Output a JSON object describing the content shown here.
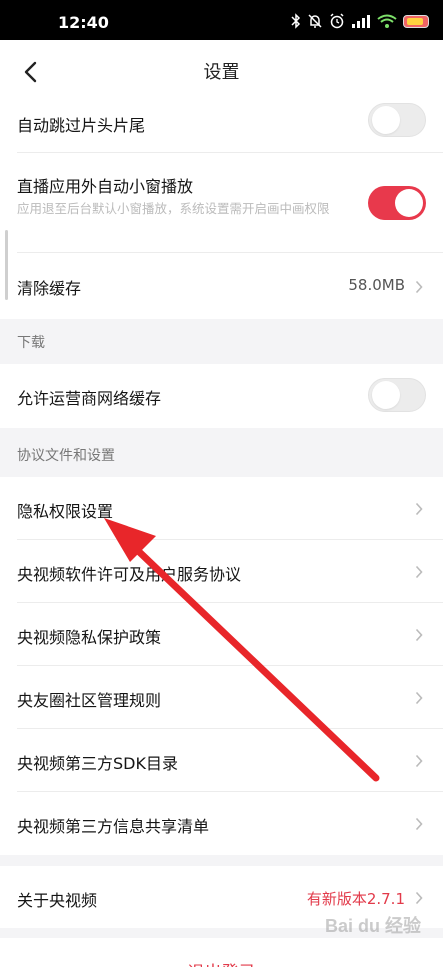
{
  "status_bar": {
    "time": "12:40"
  },
  "nav": {
    "title": "设置"
  },
  "rows": {
    "skip_intro": {
      "label": "自动跳过片头片尾",
      "on": false
    },
    "pip": {
      "label": "直播应用外自动小窗播放",
      "desc": "应用退至后台默认小窗播放，系统设置需开启画中画权限",
      "on": true
    },
    "cache": {
      "label": "清除缓存",
      "value": "58.0MB"
    },
    "carrier_cache": {
      "label": "允许运营商网络缓存",
      "on": false
    },
    "privacy_settings": {
      "label": "隐私权限设置"
    },
    "license": {
      "label": "央视频软件许可及用户服务协议"
    },
    "privacy_policy": {
      "label": "央视频隐私保护政策"
    },
    "community_rules": {
      "label": "央友圈社区管理规则"
    },
    "sdk_list": {
      "label": "央视频第三方SDK目录"
    },
    "info_share": {
      "label": "央视频第三方信息共享清单"
    },
    "about": {
      "label": "关于央视频",
      "value": "有新版本2.7.1"
    }
  },
  "sections": {
    "download": "下载",
    "agreements": "协议文件和设置"
  },
  "logout": {
    "label": "退出登录"
  },
  "watermark": "Bai du 经验",
  "colors": {
    "accent": "#e8394c",
    "background": "#f4f4f6",
    "arrow": "#e8262a"
  }
}
